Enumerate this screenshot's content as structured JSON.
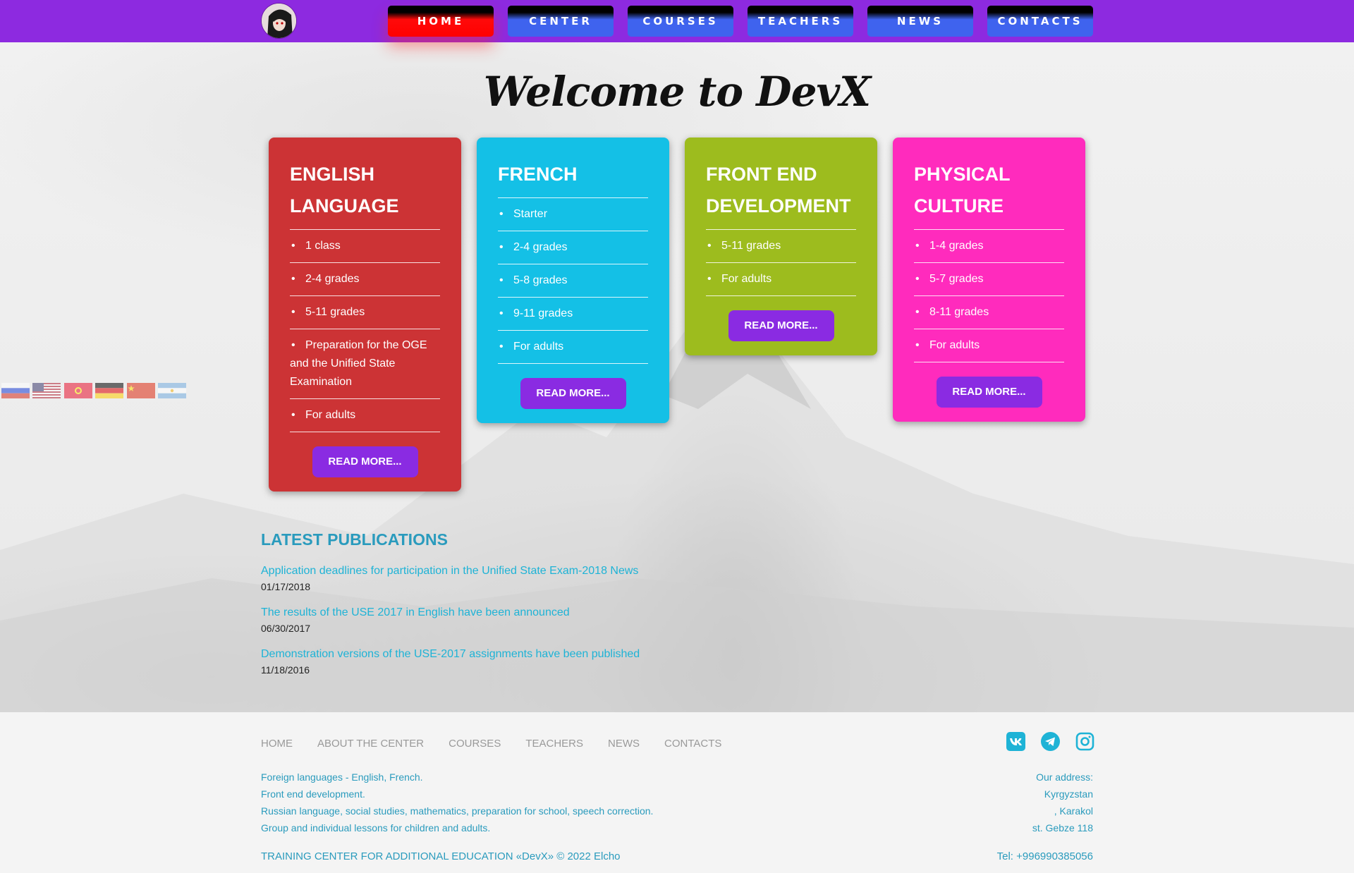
{
  "nav": {
    "items": [
      {
        "label": "HOME",
        "active": true
      },
      {
        "label": "CENTER",
        "active": false
      },
      {
        "label": "COURSES",
        "active": false
      },
      {
        "label": "TEACHERS",
        "active": false
      },
      {
        "label": "NEWS",
        "active": false
      },
      {
        "label": "CONTACTS",
        "active": false
      }
    ]
  },
  "welcome": "Welcome to DevX",
  "cards": [
    {
      "title": "ENGLISH LANGUAGE",
      "color": "#cc3335",
      "items": [
        "1 class",
        "2-4 grades",
        "5-11 grades",
        "Preparation for the OGE and the Unified State Examination",
        "For adults"
      ],
      "button": "READ MORE..."
    },
    {
      "title": "FRENCH",
      "color": "#14c0e6",
      "items": [
        "Starter",
        "2-4 grades",
        "5-8 grades",
        "9-11 grades",
        "For adults"
      ],
      "button": "READ MORE..."
    },
    {
      "title": "FRONT END DEVELOPMENT",
      "color": "#9dbc1e",
      "items": [
        "5-11 grades",
        "For adults"
      ],
      "button": "READ MORE..."
    },
    {
      "title": "PHYSICAL CULTURE",
      "color": "#ff2bbd",
      "items": [
        "1-4 grades",
        "5-7 grades",
        "8-11 grades",
        "For adults"
      ],
      "button": "READ MORE..."
    }
  ],
  "flags": [
    "russia-flag-icon",
    "usa-flag-icon",
    "kyrgyzstan-flag-icon",
    "germany-flag-icon",
    "china-flag-icon",
    "argentina-flag-icon"
  ],
  "publications": {
    "heading": "LATEST PUBLICATIONS",
    "items": [
      {
        "title": "Application deadlines for participation in the Unified State Exam-2018 News",
        "date": "01/17/2018"
      },
      {
        "title": "The results of the USE 2017 in English have been announced",
        "date": "06/30/2017"
      },
      {
        "title": "Demonstration versions of the USE-2017 assignments have been published",
        "date": "11/18/2016"
      }
    ]
  },
  "footer": {
    "nav": [
      "HOME",
      "ABOUT THE CENTER",
      "COURSES",
      "TEACHERS",
      "NEWS",
      "CONTACTS"
    ],
    "social": [
      "vk-icon",
      "telegram-icon",
      "instagram-icon"
    ],
    "description": [
      "Foreign languages - English, French.",
      "Front end development.",
      "Russian language, social studies, mathematics, preparation for school, speech correction.",
      "Group and individual lessons for children and adults."
    ],
    "address": [
      "Our address:",
      "Kyrgyzstan",
      ", Karakol",
      "st. Gebze 118"
    ],
    "copyright": "TRAINING CENTER FOR ADDITIONAL EDUCATION «DevX» © 2022 Elcho",
    "tel": "Tel: +996990385056"
  },
  "colors": {
    "header": "#8d2ae0",
    "nav_active": "#ff0000",
    "nav_default": "#3f63ee",
    "button": "#8a2be2",
    "link": "#1eb3d6",
    "heading": "#2a9bbd"
  }
}
